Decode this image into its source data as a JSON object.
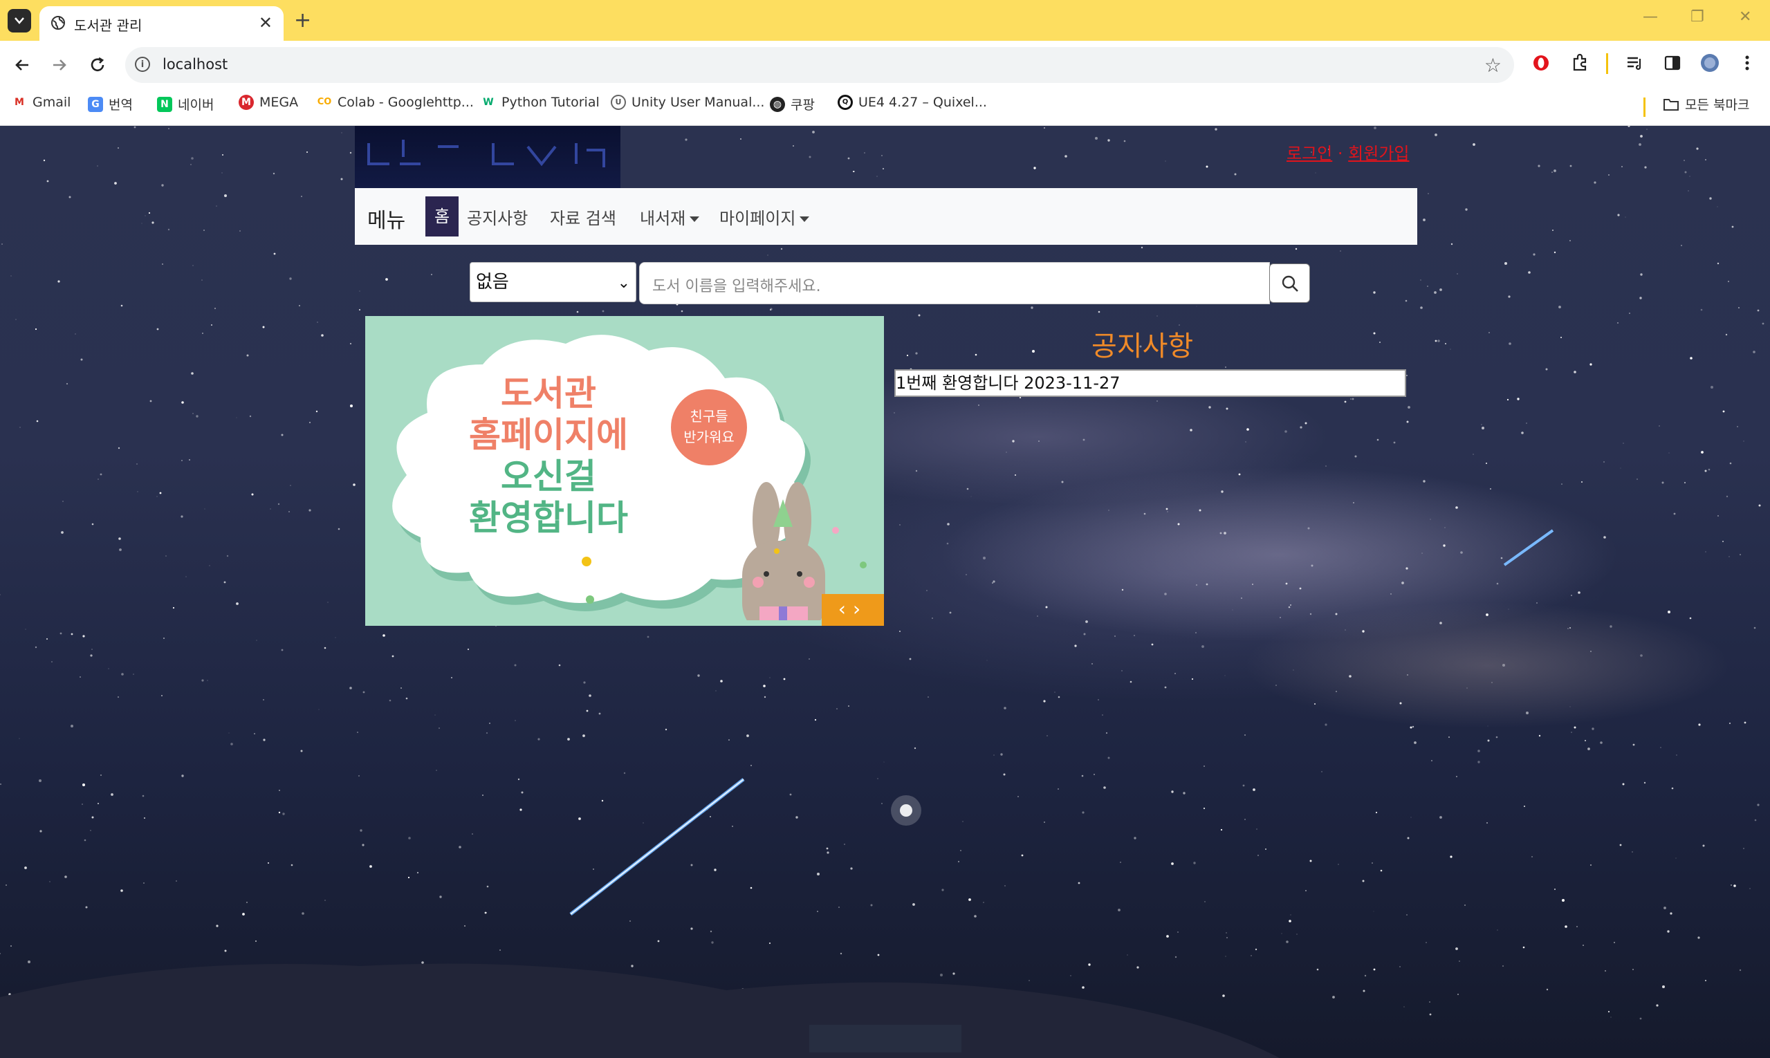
{
  "browser": {
    "tab_title": "도서관 관리",
    "url": "localhost",
    "bookmarks": [
      {
        "label": "Gmail",
        "icon": "gmail-icon"
      },
      {
        "label": "번역",
        "icon": "translate-icon"
      },
      {
        "label": "네이버",
        "icon": "naver-icon"
      },
      {
        "label": "MEGA",
        "icon": "mega-icon"
      },
      {
        "label": "Colab - Googlehttp...",
        "icon": "colab-icon"
      },
      {
        "label": "Python Tutorial",
        "icon": "w3-icon"
      },
      {
        "label": "Unity User Manual...",
        "icon": "unity-icon"
      },
      {
        "label": "쿠팡",
        "icon": "globe-icon"
      },
      {
        "label": "UE4 4.27 – Quixel...",
        "icon": "quixel-icon"
      }
    ],
    "all_bookmarks": "모든 북마크"
  },
  "header": {
    "login": "로그인",
    "signup": "회원가입"
  },
  "navbar": {
    "brand": "메뉴",
    "home": "홈",
    "notice": "공지사항",
    "search": "자료 검색",
    "my_library": "내서재",
    "my_page": "마이페이지"
  },
  "search": {
    "select_value": "없음",
    "placeholder": "도서 이름을 입력해주세요."
  },
  "banner": {
    "line1": "도서관",
    "line2": "홈페이지에",
    "line3": "오신걸",
    "line4": "환영합니다",
    "bubble_line1": "친구들",
    "bubble_line2": "반가워요"
  },
  "notice": {
    "title": "공지사항",
    "rows": [
      {
        "text": "1번째 환영합니다 2023-11-27"
      }
    ]
  },
  "colors": {
    "tab_bar": "#fdde60",
    "auth_link": "#e0141c",
    "notice_title": "#f08a28",
    "home_active": "#2b2550",
    "banner_bg": "#a9dcc5",
    "banner_control": "#ef9a1a"
  }
}
